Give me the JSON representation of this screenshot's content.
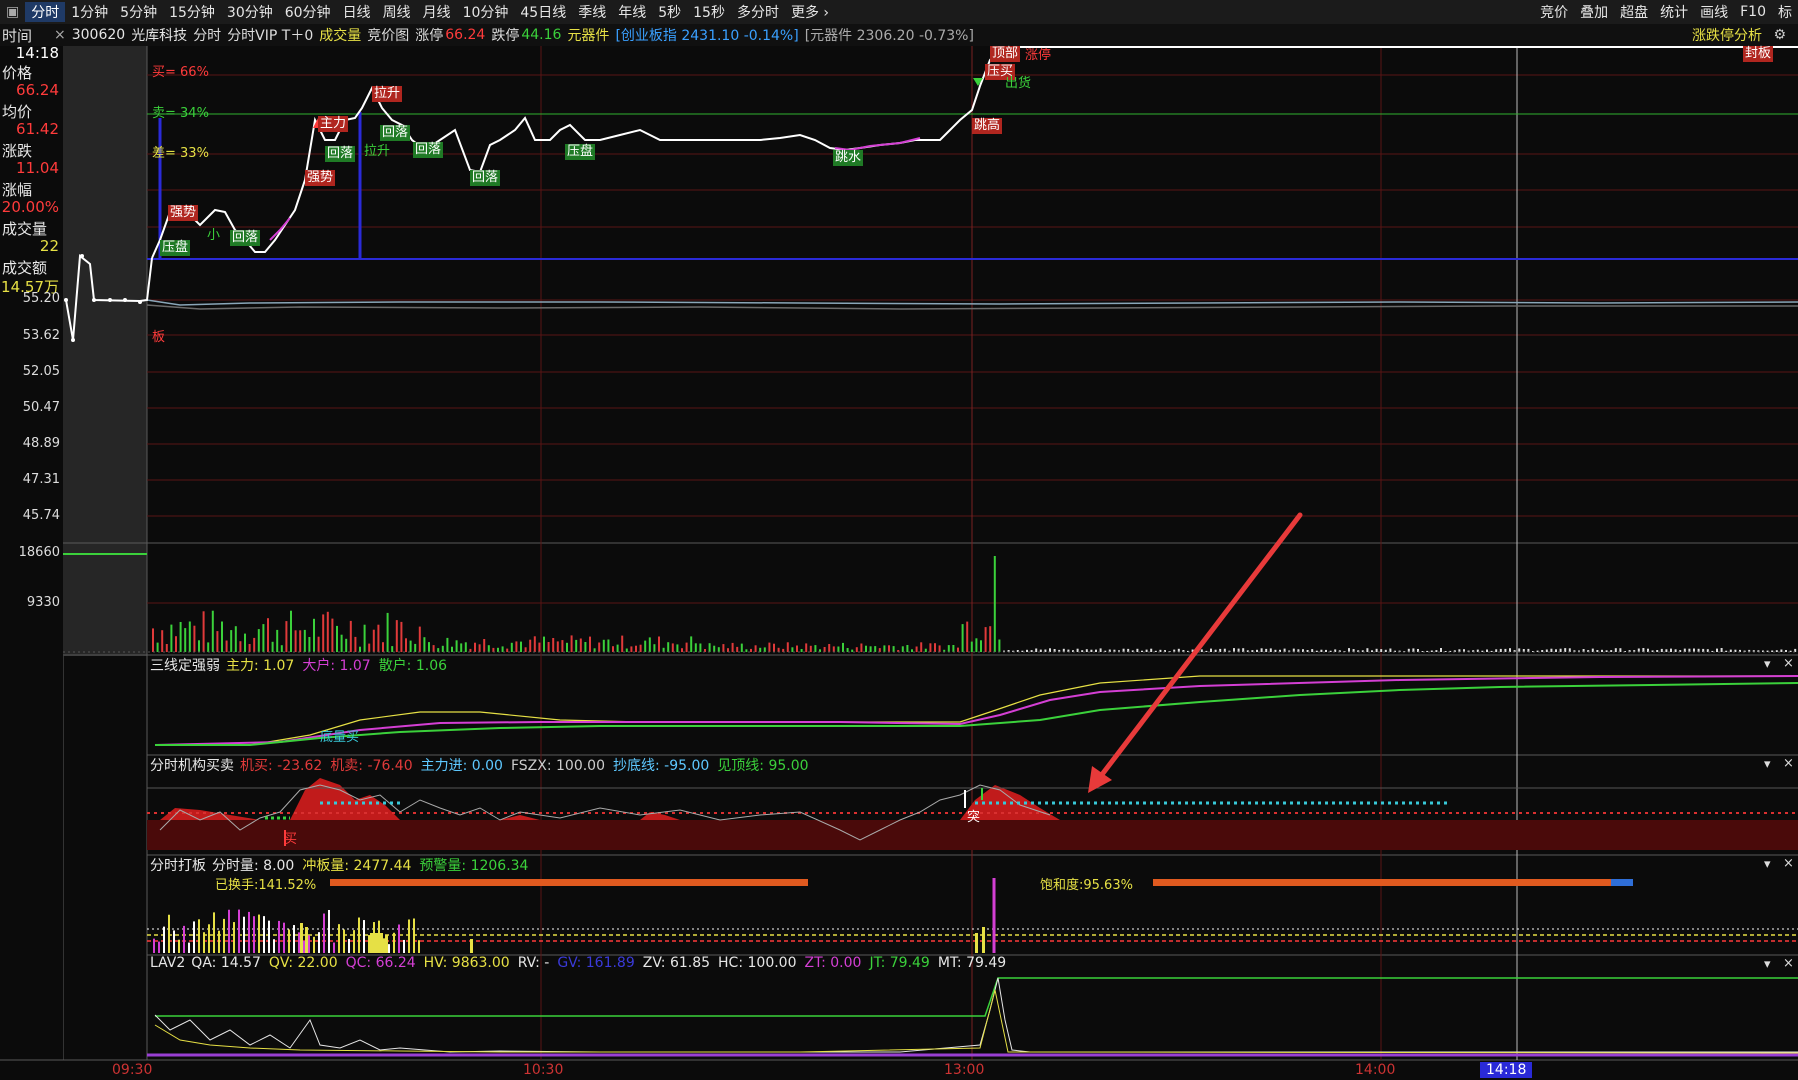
{
  "toolbar": {
    "tabs": [
      "分时",
      "1分钟",
      "5分钟",
      "15分钟",
      "30分钟",
      "60分钟",
      "日线",
      "周线",
      "月线",
      "10分钟",
      "45日线",
      "季线",
      "年线",
      "5秒",
      "15秒",
      "多分时",
      "更多 ›"
    ],
    "right": [
      "竞价",
      "叠加",
      "超盘",
      "统计",
      "画线",
      "F10",
      "标"
    ]
  },
  "info": {
    "close_x": "×",
    "code": "300620",
    "name": "光库科技",
    "mode": "分时",
    "vip": "分时VIP T＋0",
    "vol_label": "成交量",
    "auction": "竞价图",
    "up_limit_label": "涨停",
    "up_limit": "66.24",
    "down_limit_label": "跌停",
    "down_limit": "44.16",
    "sector": "元器件",
    "index1": "[创业板指 2431.10 -0.14%]",
    "index2": "[元器件 2306.20 -0.73%]",
    "analysis": "涨跌停分析",
    "gear_icon": "⚙"
  },
  "sidebar": {
    "time_label": "时间",
    "time": "14:18",
    "price_label": "价格",
    "price": "66.24",
    "avg_label": "均价",
    "avg": "61.42",
    "chg_label": "涨跌",
    "chg": "11.04",
    "pct_label": "涨幅",
    "pct": "20.00%",
    "vol_label": "成交量",
    "vol": "22",
    "amt_label": "成交额",
    "amt": "14.57万",
    "panel_close": "×"
  },
  "price_axis": [
    "55.20",
    "53.62",
    "52.05",
    "50.47",
    "48.89",
    "47.31",
    "45.74"
  ],
  "vol_axis": [
    "18660",
    "9330"
  ],
  "main_labels": {
    "buy": "买= 66%",
    "sell": "卖= 34%",
    "diff": "差= 33%",
    "ban": "板",
    "zhangting": "涨停",
    "fengban": "封板",
    "tags": [
      {
        "t": "主力",
        "c": "r"
      },
      {
        "t": "强势",
        "c": "r"
      },
      {
        "t": "压盘",
        "c": "g"
      },
      {
        "t": "小",
        "c": "t"
      },
      {
        "t": "回落",
        "c": "g"
      },
      {
        "t": "强势",
        "c": "r"
      },
      {
        "t": "拉升",
        "c": "r"
      },
      {
        "t": "回落",
        "c": "g"
      },
      {
        "t": "拉升",
        "c": "t"
      },
      {
        "t": "回落",
        "c": "g"
      },
      {
        "t": "回落",
        "c": "g"
      },
      {
        "t": "回落",
        "c": "g"
      },
      {
        "t": "压盘",
        "c": "g"
      },
      {
        "t": "跳水",
        "c": "g"
      },
      {
        "t": "跳高",
        "c": "r"
      },
      {
        "t": "顶部",
        "c": "r"
      },
      {
        "t": "压买",
        "c": "r"
      },
      {
        "t": "出货",
        "c": "t"
      }
    ]
  },
  "panels": {
    "p1": {
      "title": "三线定强弱",
      "items": [
        {
          "l": "主力: 1.07",
          "c": "#e6e045"
        },
        {
          "l": "大户: 1.07",
          "c": "#d43fd4"
        },
        {
          "l": "散户: 1.06",
          "c": "#3bd13b"
        }
      ],
      "tag": "底量买"
    },
    "p2": {
      "title": "分时机构买卖",
      "items": [
        {
          "l": "机买: -23.62",
          "c": "#e03a3a"
        },
        {
          "l": "机卖: -76.40",
          "c": "#e03a3a"
        },
        {
          "l": "主力进: 0.00",
          "c": "#5ec8ff"
        },
        {
          "l": "FSZX: 100.00",
          "c": "#cccccc"
        },
        {
          "l": "抄底线: -95.00",
          "c": "#5ec8ff"
        },
        {
          "l": "见顶线: 95.00",
          "c": "#3bd13b"
        }
      ],
      "tag": "突",
      "tag2": "买"
    },
    "p3": {
      "title": "分时打板",
      "items": [
        {
          "l": "分时量: 8.00",
          "c": "#e6e6e6"
        },
        {
          "l": "冲板量: 2477.44",
          "c": "#e6e045"
        },
        {
          "l": "预警量: 1206.34",
          "c": "#3bd13b"
        }
      ],
      "turnover": "已换手:141.52%",
      "saturation": "饱和度:95.63%"
    },
    "p4": {
      "title": "LAV2",
      "items": [
        {
          "l": "QA: 14.57",
          "c": "#e6e6e6"
        },
        {
          "l": "QV: 22.00",
          "c": "#e6e045"
        },
        {
          "l": "QC: 66.24",
          "c": "#d43fd4"
        },
        {
          "l": "HV: 9863.00",
          "c": "#e6e045"
        },
        {
          "l": "RV: -",
          "c": "#e6e6e6"
        },
        {
          "l": "GV: 161.89",
          "c": "#3a3ad9"
        },
        {
          "l": "ZV: 61.85",
          "c": "#e6e6e6"
        },
        {
          "l": "HC: 100.00",
          "c": "#e6e6e6"
        },
        {
          "l": "ZT: 0.00",
          "c": "#d43fd4"
        },
        {
          "l": "JT: 79.49",
          "c": "#3bd13b"
        },
        {
          "l": "MT: 79.49",
          "c": "#e6e6e6"
        }
      ]
    }
  },
  "panel_ctrl": {
    "down": "▾",
    "close": "×"
  },
  "x_axis": {
    "t1": "09:30",
    "t2": "10:30",
    "t3": "13:00",
    "t4": "14:00",
    "cursor": "14:18"
  },
  "colors": {
    "up": "#ff3b3b",
    "down": "#3bd13b",
    "accent": "#1f3a66"
  }
}
